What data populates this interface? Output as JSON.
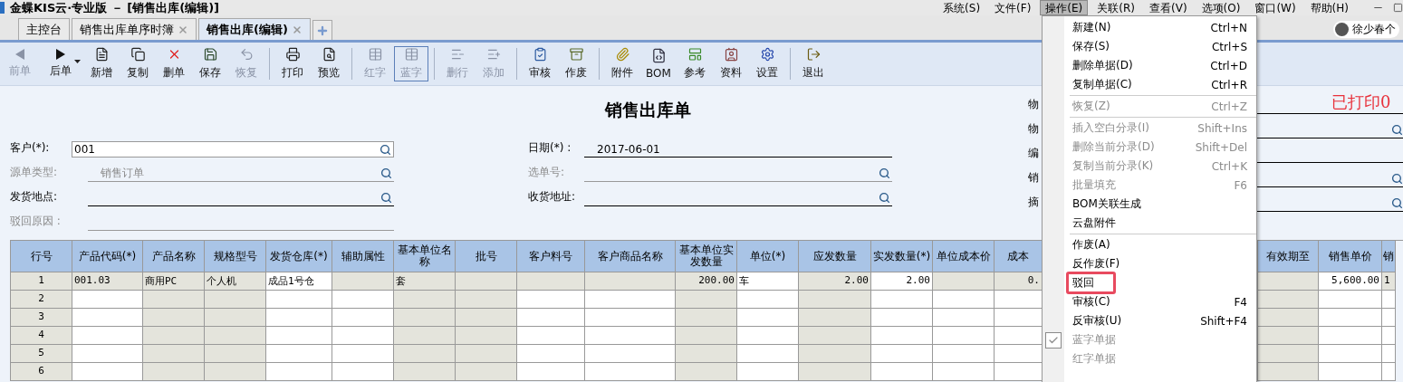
{
  "window": {
    "title": "金蝶KIS云·专业版 － [销售出库(编辑)]"
  },
  "menu_bar": [
    {
      "label": "系统(S)",
      "selected": false
    },
    {
      "label": "文件(F)",
      "selected": false
    },
    {
      "label": "操作(E)",
      "selected": true
    },
    {
      "label": "关联(R)",
      "selected": false
    },
    {
      "label": "查看(V)",
      "selected": false
    },
    {
      "label": "选项(O)",
      "selected": false
    },
    {
      "label": "窗口(W)",
      "selected": false
    },
    {
      "label": "帮助(H)",
      "selected": false
    }
  ],
  "tabs": [
    {
      "label": "主控台",
      "selected": false,
      "closable": false
    },
    {
      "label": "销售出库单序时簿",
      "selected": false,
      "closable": true
    },
    {
      "label": "销售出库(编辑)",
      "selected": true,
      "closable": true
    }
  ],
  "user": {
    "name": "徐少春个"
  },
  "toolbar": [
    {
      "kind": "button",
      "label": "前单",
      "disabled": true,
      "selected": false,
      "dropdown": false
    },
    {
      "kind": "button",
      "label": "后单",
      "disabled": false,
      "selected": false,
      "dropdown": true
    },
    {
      "kind": "button",
      "label": "新增",
      "disabled": false,
      "selected": false,
      "dropdown": false
    },
    {
      "kind": "button",
      "label": "复制",
      "disabled": false,
      "selected": false,
      "dropdown": false
    },
    {
      "kind": "button",
      "label": "删单",
      "disabled": false,
      "selected": false,
      "dropdown": false
    },
    {
      "kind": "button",
      "label": "保存",
      "disabled": false,
      "selected": false,
      "dropdown": false
    },
    {
      "kind": "button",
      "label": "恢复",
      "disabled": true,
      "selected": false,
      "dropdown": false
    },
    {
      "kind": "separator"
    },
    {
      "kind": "button",
      "label": "打印",
      "disabled": false,
      "selected": false,
      "dropdown": false
    },
    {
      "kind": "button",
      "label": "预览",
      "disabled": false,
      "selected": false,
      "dropdown": false
    },
    {
      "kind": "separator"
    },
    {
      "kind": "button",
      "label": "红字",
      "disabled": true,
      "selected": false,
      "dropdown": false
    },
    {
      "kind": "button",
      "label": "蓝字",
      "disabled": true,
      "selected": true,
      "dropdown": false
    },
    {
      "kind": "separator"
    },
    {
      "kind": "button",
      "label": "删行",
      "disabled": true,
      "selected": false,
      "dropdown": false
    },
    {
      "kind": "button",
      "label": "添加",
      "disabled": true,
      "selected": false,
      "dropdown": false
    },
    {
      "kind": "separator"
    },
    {
      "kind": "button",
      "label": "审核",
      "disabled": false,
      "selected": false,
      "dropdown": false
    },
    {
      "kind": "button",
      "label": "作废",
      "disabled": false,
      "selected": false,
      "dropdown": false
    },
    {
      "kind": "separator"
    },
    {
      "kind": "button",
      "label": "附件",
      "disabled": false,
      "selected": false,
      "dropdown": false
    },
    {
      "kind": "button",
      "label": "BOM",
      "disabled": false,
      "selected": false,
      "dropdown": false
    },
    {
      "kind": "button",
      "label": "参考",
      "disabled": false,
      "selected": false,
      "dropdown": false
    },
    {
      "kind": "button",
      "label": "资料",
      "disabled": false,
      "selected": false,
      "dropdown": false
    },
    {
      "kind": "button",
      "label": "设置",
      "disabled": false,
      "selected": false,
      "dropdown": false
    },
    {
      "kind": "separator"
    },
    {
      "kind": "button",
      "label": "退出",
      "disabled": false,
      "selected": false,
      "dropdown": false
    }
  ],
  "form": {
    "title": "销售出库单",
    "print_stamp": "已打印0",
    "rows": [
      [
        {
          "label": "客户(*):",
          "value": "001",
          "kind": "input",
          "disabled": false,
          "lookup": true
        },
        {
          "label": "日期(*) :",
          "value": "2017-06-01",
          "kind": "line",
          "disabled": false,
          "lookup": false
        }
      ],
      [
        {
          "label": "源单类型:",
          "value": "销售订单",
          "kind": "line",
          "disabled": true,
          "lookup": true
        },
        {
          "label": "选单号:",
          "kind": "line",
          "disabled": true,
          "lookup": true
        }
      ],
      [
        {
          "label": "发货地点:",
          "kind": "line",
          "disabled": false,
          "lookup": true
        },
        {
          "label": "收货地址:",
          "kind": "line",
          "disabled": false,
          "lookup": true
        }
      ],
      [
        {
          "label": "驳回原因 :",
          "kind": "line",
          "disabled": true,
          "lookup": false
        }
      ]
    ],
    "right_fields": [
      {
        "label": "物",
        "lookup": false
      },
      {
        "label": "物",
        "lookup": true
      },
      {
        "label": "编",
        "lookup": false
      },
      {
        "label": "销",
        "lookup": true
      },
      {
        "label": "摘",
        "lookup": true
      }
    ]
  },
  "table": {
    "columns": [
      {
        "label": "行号",
        "readonly": true
      },
      {
        "label": "产品代码(*)",
        "readonly": false
      },
      {
        "label": "产品名称",
        "readonly": true
      },
      {
        "label": "规格型号",
        "readonly": true
      },
      {
        "label": "发货仓库(*)",
        "readonly": false
      },
      {
        "label": "辅助属性",
        "readonly": false
      },
      {
        "label": "基本单位名称",
        "readonly": true
      },
      {
        "label": "批号",
        "readonly": true
      },
      {
        "label": "客户料号",
        "readonly": false
      },
      {
        "label": "客户商品名称",
        "readonly": false
      },
      {
        "label": "基本单位实发数量",
        "readonly": true
      },
      {
        "label": "单位(*)",
        "readonly": false
      },
      {
        "label": "应发数量",
        "readonly": true
      },
      {
        "label": "实发数量(*)",
        "readonly": false
      },
      {
        "label": "单位成本价",
        "readonly": false
      },
      {
        "label": "成本",
        "readonly": false
      },
      {
        "label": "有效期至",
        "readonly": true
      },
      {
        "label": "销售单价",
        "readonly": false
      },
      {
        "label": "销",
        "readonly": false
      }
    ],
    "rows": [
      {
        "selected": true,
        "cells": [
          "1",
          "001.03",
          "商用PC",
          "个人机",
          "成品1号仓",
          null,
          "套",
          null,
          null,
          null,
          "200.00",
          "车",
          "2.00",
          "2.00",
          null,
          "0.",
          null,
          "5,600.00",
          "1"
        ]
      },
      {
        "selected": false,
        "cells": [
          "2",
          null,
          null,
          null,
          null,
          null,
          null,
          null,
          null,
          null,
          null,
          null,
          null,
          null,
          null,
          null,
          null,
          null,
          null
        ]
      },
      {
        "selected": false,
        "cells": [
          "3",
          null,
          null,
          null,
          null,
          null,
          null,
          null,
          null,
          null,
          null,
          null,
          null,
          null,
          null,
          null,
          null,
          null,
          null
        ]
      },
      {
        "selected": false,
        "cells": [
          "4",
          null,
          null,
          null,
          null,
          null,
          null,
          null,
          null,
          null,
          null,
          null,
          null,
          null,
          null,
          null,
          null,
          null,
          null
        ]
      },
      {
        "selected": false,
        "cells": [
          "5",
          null,
          null,
          null,
          null,
          null,
          null,
          null,
          null,
          null,
          null,
          null,
          null,
          null,
          null,
          null,
          null,
          null,
          null
        ]
      },
      {
        "selected": false,
        "cells": [
          "6",
          null,
          null,
          null,
          null,
          null,
          null,
          null,
          null,
          null,
          null,
          null,
          null,
          null,
          null,
          null,
          null,
          null,
          null
        ]
      }
    ]
  },
  "dropdown_menu": [
    {
      "kind": "item",
      "label": "新建(N)",
      "shortcut": "Ctrl+N",
      "disabled": false,
      "checked": false,
      "marked": false
    },
    {
      "kind": "item",
      "label": "保存(S)",
      "shortcut": "Ctrl+S",
      "disabled": false,
      "checked": false,
      "marked": false
    },
    {
      "kind": "item",
      "label": "删除单据(D)",
      "shortcut": "Ctrl+D",
      "disabled": false,
      "checked": false,
      "marked": false
    },
    {
      "kind": "item",
      "label": "复制单据(C)",
      "shortcut": "Ctrl+R",
      "disabled": false,
      "checked": false,
      "marked": false
    },
    {
      "kind": "separator"
    },
    {
      "kind": "item",
      "label": "恢复(Z)",
      "shortcut": "Ctrl+Z",
      "disabled": true,
      "checked": false,
      "marked": false
    },
    {
      "kind": "separator"
    },
    {
      "kind": "item",
      "label": "插入空白分录(I)",
      "shortcut": "Shift+Ins",
      "disabled": true,
      "checked": false,
      "marked": false
    },
    {
      "kind": "item",
      "label": "删除当前分录(D)",
      "shortcut": "Shift+Del",
      "disabled": true,
      "checked": false,
      "marked": false
    },
    {
      "kind": "item",
      "label": "复制当前分录(K)",
      "shortcut": "Ctrl+K",
      "disabled": true,
      "checked": false,
      "marked": false
    },
    {
      "kind": "item",
      "label": "批量填充",
      "shortcut": "F6",
      "disabled": true,
      "checked": false,
      "marked": false
    },
    {
      "kind": "item",
      "label": "BOM关联生成",
      "disabled": false,
      "checked": false,
      "marked": false
    },
    {
      "kind": "item",
      "label": "云盘附件",
      "disabled": false,
      "checked": false,
      "marked": false
    },
    {
      "kind": "separator"
    },
    {
      "kind": "item",
      "label": "作废(A)",
      "disabled": false,
      "checked": false,
      "marked": false
    },
    {
      "kind": "item",
      "label": "反作废(F)",
      "disabled": false,
      "checked": false,
      "marked": false
    },
    {
      "kind": "item",
      "label": "驳回",
      "disabled": false,
      "checked": false,
      "marked": true
    },
    {
      "kind": "item",
      "label": "审核(C)",
      "shortcut": "F4",
      "disabled": false,
      "checked": false,
      "marked": false
    },
    {
      "kind": "item",
      "label": "反审核(U)",
      "shortcut": "Shift+F4",
      "disabled": false,
      "checked": false,
      "marked": false
    },
    {
      "kind": "item",
      "label": "蓝字单据",
      "disabled": true,
      "checked": true,
      "marked": false
    },
    {
      "kind": "item",
      "label": "红字单据",
      "disabled": true,
      "checked": false,
      "marked": false
    }
  ]
}
